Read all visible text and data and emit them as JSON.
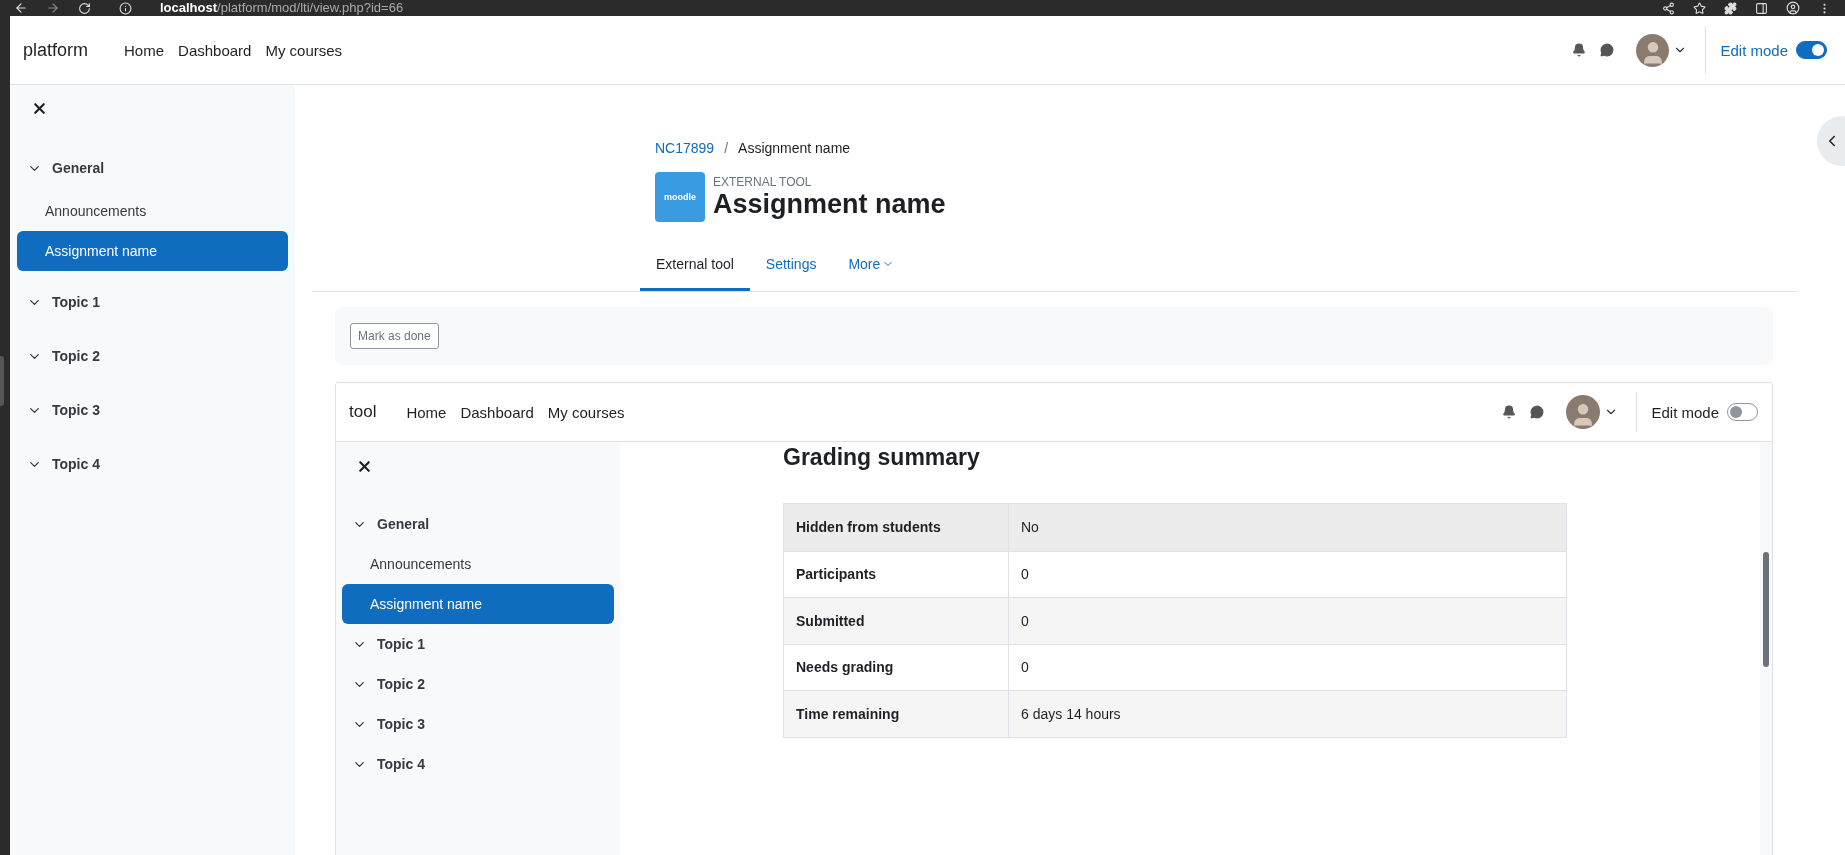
{
  "browser": {
    "url_host": "localhost",
    "url_path": "/platform/mod/lti/view.php?id=66"
  },
  "navbar": {
    "brand": "platform",
    "links": [
      "Home",
      "Dashboard",
      "My courses"
    ],
    "edit_mode": {
      "label": "Edit mode",
      "on": true
    }
  },
  "drawer": {
    "sections": [
      {
        "title": "General",
        "expanded": true,
        "items": [
          {
            "label": "Announcements",
            "selected": false
          },
          {
            "label": "Assignment name",
            "selected": true
          }
        ]
      },
      {
        "title": "Topic 1",
        "expanded": true
      },
      {
        "title": "Topic 2",
        "expanded": true
      },
      {
        "title": "Topic 3",
        "expanded": true
      },
      {
        "title": "Topic 4",
        "expanded": true
      }
    ]
  },
  "breadcrumb": {
    "separator": "/",
    "items": [
      {
        "label": "NC17899",
        "link": true
      },
      {
        "label": "Assignment name",
        "link": false
      }
    ]
  },
  "header": {
    "logo_text": "moodle",
    "activity_type": "EXTERNAL TOOL",
    "title": "Assignment name"
  },
  "tabs": [
    {
      "label": "External tool",
      "selected": true,
      "dropdown": false
    },
    {
      "label": "Settings",
      "selected": false,
      "dropdown": false
    },
    {
      "label": "More",
      "selected": false,
      "dropdown": true
    }
  ],
  "completion": {
    "button": "Mark as done"
  },
  "embedded": {
    "navbar": {
      "brand": "tool",
      "links": [
        "Home",
        "Dashboard",
        "My courses"
      ],
      "edit_mode": {
        "label": "Edit mode",
        "on": false
      }
    },
    "drawer": {
      "sections": [
        {
          "title": "General",
          "expanded": true,
          "items": [
            {
              "label": "Announcements",
              "selected": false
            },
            {
              "label": "Assignment name",
              "selected": true
            }
          ]
        },
        {
          "title": "Topic 1",
          "expanded": true
        },
        {
          "title": "Topic 2",
          "expanded": true
        },
        {
          "title": "Topic 3",
          "expanded": true
        },
        {
          "title": "Topic 4",
          "expanded": true
        }
      ]
    },
    "heading": "Grading summary",
    "summary": [
      {
        "label": "Hidden from students",
        "value": "No"
      },
      {
        "label": "Participants",
        "value": "0"
      },
      {
        "label": "Submitted",
        "value": "0"
      },
      {
        "label": "Needs grading",
        "value": "0"
      },
      {
        "label": "Time remaining",
        "value": "6 days 14 hours"
      }
    ]
  }
}
